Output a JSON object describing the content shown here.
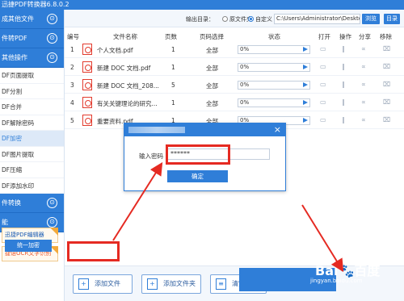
{
  "title_bar": "迅捷PDF转换器6.8.0.2",
  "sidebar": {
    "sections": [
      {
        "label": "成其他文件",
        "symbol": "⊙"
      },
      {
        "label": "件转PDF",
        "symbol": "⊙"
      },
      {
        "label": "其他操作",
        "symbol": "⊙"
      }
    ],
    "items": [
      {
        "label": "DF页面提取"
      },
      {
        "label": "DF分割"
      },
      {
        "label": "DF合并"
      },
      {
        "label": "DF解除密码"
      },
      {
        "label": "DF加密"
      },
      {
        "label": "DF图片提取"
      },
      {
        "label": "DF压缩"
      },
      {
        "label": "DF添加水印"
      }
    ],
    "bottom_sections": [
      {
        "label": "件转换",
        "symbol": "⊙"
      },
      {
        "label": "能",
        "symbol": "⊙"
      }
    ],
    "promos": [
      {
        "label": "迅捷PDF编辑器"
      },
      {
        "label": "捷语OCR文字识别"
      }
    ]
  },
  "output": {
    "label": "输出目录：",
    "radio_original": "原文件夹",
    "radio_custom": "自定义",
    "path": "C:\\Users\\Administrator\\Deskto",
    "browse": "浏览",
    "directory": "目录"
  },
  "table": {
    "headers": [
      "编号",
      "文件名称",
      "页数",
      "页码选择",
      "状态",
      "打开",
      "操作",
      "分享",
      "移除"
    ],
    "rows": [
      {
        "num": "1",
        "name": "个人文档.pdf",
        "pages": "1",
        "range": "全部",
        "status": "0%"
      },
      {
        "num": "2",
        "name": "新建 DOC 文档.pdf",
        "pages": "1",
        "range": "全部",
        "status": "0%"
      },
      {
        "num": "3",
        "name": "新建 DOC 文档_208...",
        "pages": "5",
        "range": "全部",
        "status": "0%"
      },
      {
        "num": "4",
        "name": "有关关键理论的研究...",
        "pages": "1",
        "range": "全部",
        "status": "0%"
      },
      {
        "num": "5",
        "name": "重要资料.pdf",
        "pages": "1",
        "range": "全部",
        "status": "0%"
      }
    ]
  },
  "dialog": {
    "label": "输入密码",
    "password": "******",
    "ok": "确定",
    "close": "×"
  },
  "toolbar": {
    "unified_encrypt": "统一加密",
    "add_file": "添加文件",
    "add_folder": "添加文件夹",
    "clear_list": "清空列表"
  },
  "watermark": {
    "logo": "Bai🐾百度",
    "url": "jingyan.baidu.com"
  },
  "colors": {
    "accent": "#2f7ed8",
    "highlight": "#e52a22"
  }
}
